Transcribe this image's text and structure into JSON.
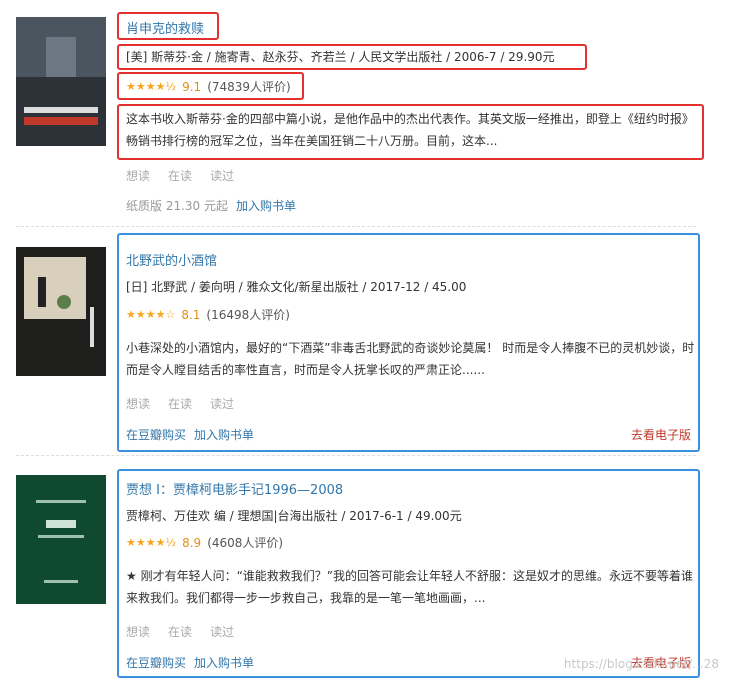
{
  "books": [
    {
      "title": "肖申克的救赎",
      "pub": "[美] 斯蒂芬·金 / 施寄青、赵永芬、齐若兰 / 人民文学出版社 / 2006-7 / 29.90元",
      "stars": "★★★★½",
      "score": "9.1",
      "count": "(74839人评价)",
      "desc": "这本书收入斯蒂芬·金的四部中篇小说，是他作品中的杰出代表作。其英文版一经推出，即登上《纽约时报》畅销书排行榜的冠军之位，当年在美国狂销二十八万册。目前，这本...",
      "actions": [
        "想读",
        "在读",
        "读过"
      ],
      "buy_primary": "纸质版 21.30 元起",
      "buy_secondary": "加入购书单",
      "ebook": ""
    },
    {
      "title": "北野武的小酒馆",
      "pub": "[日] 北野武 / 姜向明 / 雅众文化/新星出版社 / 2017-12 / 45.00",
      "stars": "★★★★☆",
      "score": "8.1",
      "count": "(16498人评价)",
      "desc": "小巷深处的小酒馆内，最好的“下酒菜”非毒舌北野武的奇谈妙论莫属！ 时而是令人捧腹不已的灵机妙谈，时而是令人瞠目结舌的率性直言，时而是令人抚掌长叹的严肃正论......",
      "actions": [
        "想读",
        "在读",
        "读过"
      ],
      "buy_primary": "在豆瓣购买",
      "buy_secondary": "加入购书单",
      "ebook": "去看电子版"
    },
    {
      "title": "贾想 I：贾樟柯电影手记1996—2008",
      "pub": "贾樟柯、万佳欢 编 / 理想国|台海出版社 / 2017-6-1 / 49.00元",
      "stars": "★★★★½",
      "score": "8.9",
      "count": "(4608人评价)",
      "desc": "★ 刚才有年轻人问：“谁能救救我们？”我的回答可能会让年轻人不舒服：这是奴才的思维。永远不要等着谁来救我们。我们都得一步一步救自己，我靠的是一笔一笔地画画，...",
      "actions": [
        "想读",
        "在读",
        "读过"
      ],
      "buy_primary": "在豆瓣购买",
      "buy_secondary": "加入购书单",
      "ebook": "去看电子版"
    }
  ],
  "watermark": "https://blog.csdn.net/...28",
  "colors": {
    "highlight_red": "#e53030",
    "highlight_blue": "#3b90e0",
    "link": "#37a",
    "star": "#f6a623"
  }
}
